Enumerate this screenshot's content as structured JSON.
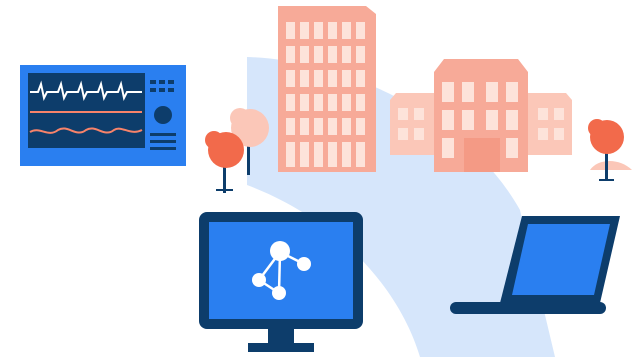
{
  "scene": {
    "colors": {
      "arc": "#d6e6fb",
      "navy": "#0d3d6b",
      "blue": "#2a7ff0",
      "salmon": "#f7aa98",
      "salmon_light": "#fbc7b8",
      "coral": "#f26a4b",
      "white": "#ffffff",
      "ecg_line": "#ffffff",
      "ecg_wave": "#f7836a"
    },
    "icons": [
      "patient-monitor-icon",
      "office-tower-icon",
      "hospital-building-icon",
      "tree-icon",
      "desktop-network-icon",
      "laptop-icon"
    ]
  }
}
